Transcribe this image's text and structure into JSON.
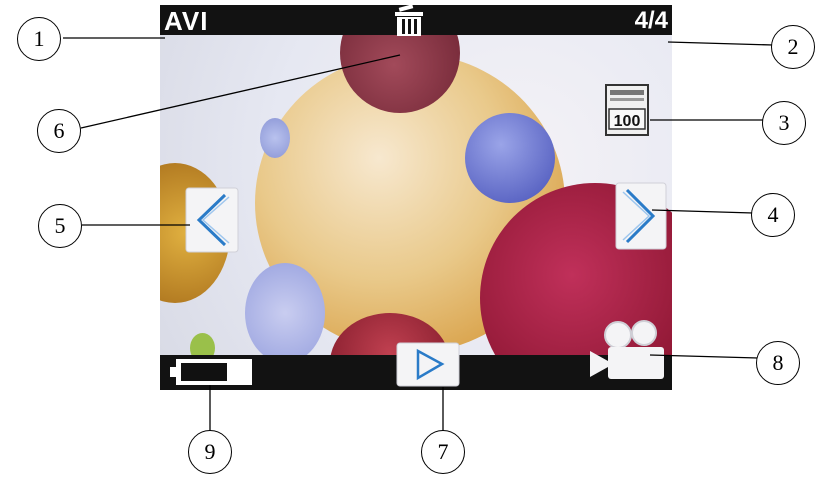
{
  "screen": {
    "mode_label": "AVI",
    "file_counter": "4/4",
    "storage_badge": "100",
    "icons": {
      "delete": "trash-icon",
      "storage": "memory-card-icon",
      "previous": "chevron-left-icon",
      "next": "chevron-right-icon",
      "play": "play-icon",
      "video_mode": "video-camera-icon",
      "battery": "battery-icon"
    },
    "battery_level": 0.7
  },
  "callouts": [
    "1",
    "2",
    "3",
    "4",
    "5",
    "6",
    "7",
    "8",
    "9"
  ]
}
